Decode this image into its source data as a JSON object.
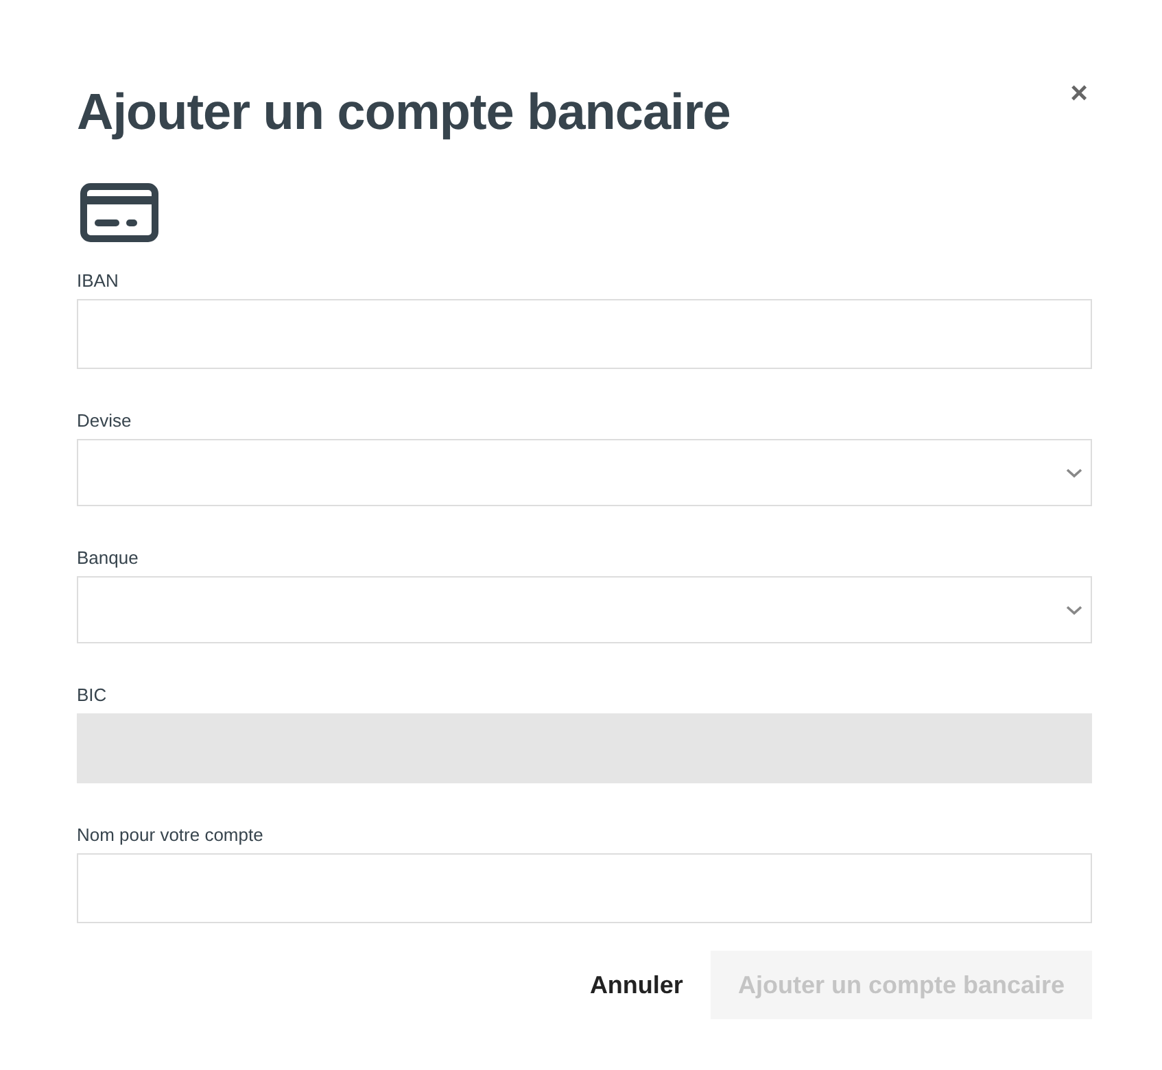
{
  "dialog": {
    "title": "Ajouter un compte bancaire",
    "close": "×"
  },
  "fields": [
    {
      "label": "IBAN",
      "kind": "text",
      "disabled": false
    },
    {
      "label": "Devise",
      "kind": "select",
      "disabled": false
    },
    {
      "label": "Banque",
      "kind": "select",
      "disabled": false
    },
    {
      "label": "BIC",
      "kind": "text",
      "disabled": true
    },
    {
      "label": "Nom pour votre compte",
      "kind": "text",
      "disabled": false
    }
  ],
  "buttons": {
    "cancel": {
      "label": "Annuler",
      "disabled": false
    },
    "submit": {
      "label": "Ajouter un compte bancaire",
      "disabled": true
    }
  }
}
